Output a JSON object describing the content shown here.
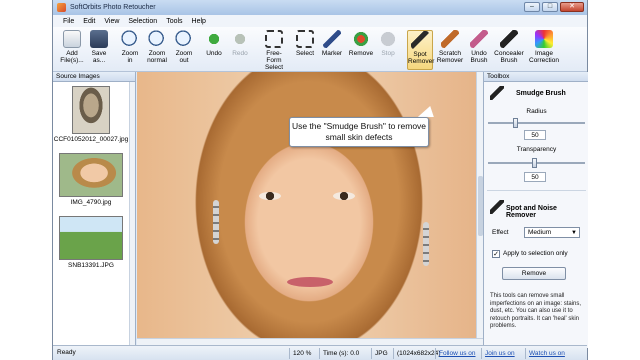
{
  "window": {
    "title": "SoftOrbits Photo Retoucher"
  },
  "titlebar_buttons": {
    "minimize": "–",
    "maximize": "□",
    "close": "✕"
  },
  "menu": [
    "File",
    "Edit",
    "View",
    "Selection",
    "Tools",
    "Help"
  ],
  "toolbar": [
    {
      "id": "add",
      "label": "Add\nFile(s)...",
      "icon": "add-files-icon"
    },
    {
      "id": "save",
      "label": "Save\nas...",
      "icon": "save-icon"
    },
    {
      "id": "zoom-in",
      "label": "Zoom\nin",
      "icon": "zoom-in-icon"
    },
    {
      "id": "zoom-normal",
      "label": "Zoom\nnormal",
      "icon": "zoom-normal-icon"
    },
    {
      "id": "zoom-out",
      "label": "Zoom\nout",
      "icon": "zoom-out-icon"
    },
    {
      "id": "undo",
      "label": "Undo",
      "icon": "undo-icon"
    },
    {
      "id": "redo",
      "label": "Redo",
      "icon": "redo-icon"
    },
    {
      "id": "free-form-select",
      "label": "Free-Form\nSelect",
      "icon": "free-form-select-icon"
    },
    {
      "id": "select",
      "label": "Select",
      "icon": "select-icon"
    },
    {
      "id": "marker",
      "label": "Marker",
      "icon": "marker-icon"
    },
    {
      "id": "remove",
      "label": "Remove",
      "icon": "remove-icon"
    },
    {
      "id": "stop",
      "label": "Stop",
      "icon": "stop-icon"
    },
    {
      "id": "spot-remover",
      "label": "Spot\nRemover",
      "icon": "spot-remover-icon"
    },
    {
      "id": "scratch-remover",
      "label": "Scratch\nRemover",
      "icon": "scratch-remover-icon"
    },
    {
      "id": "undo-brush",
      "label": "Undo\nBrush",
      "icon": "undo-brush-icon"
    },
    {
      "id": "concealer-brush",
      "label": "Concealer\nBrush",
      "icon": "concealer-brush-icon"
    },
    {
      "id": "image-correction",
      "label": "Image\nCorrection",
      "icon": "image-correction-icon"
    }
  ],
  "source_images": {
    "header": "Source Images",
    "items": [
      {
        "filename": "CCF01052012_00027.jpg"
      },
      {
        "filename": "IMG_4790.jpg"
      },
      {
        "filename": "SNB13391.JPG"
      }
    ]
  },
  "callout": {
    "text": "Use the \"Smudge Brush\" to remove small skin defects"
  },
  "toolbox": {
    "header": "Toolbox",
    "smudge": {
      "title": "Smudge Brush",
      "radius_label": "Radius",
      "radius_value": "50",
      "transparency_label": "Transparency",
      "transparency_value": "50"
    },
    "spot": {
      "title": "Spot and Noise Remover",
      "effect_label": "Effect",
      "effect_value": "Medium",
      "apply_label": "Apply to selection only",
      "remove_button": "Remove",
      "description": "This tools can remove small imperfections on an image: stains, dust, etc. You can also use it to retouch portraits. It can 'heal' skin problems."
    }
  },
  "status": {
    "ready": "Ready",
    "zoom": "120 %",
    "time": "Time (s): 0.0",
    "format": "JPG",
    "size": "(1024x682x24)",
    "follow": "Follow us on",
    "join": "Join us on",
    "watch": "Watch us on"
  }
}
